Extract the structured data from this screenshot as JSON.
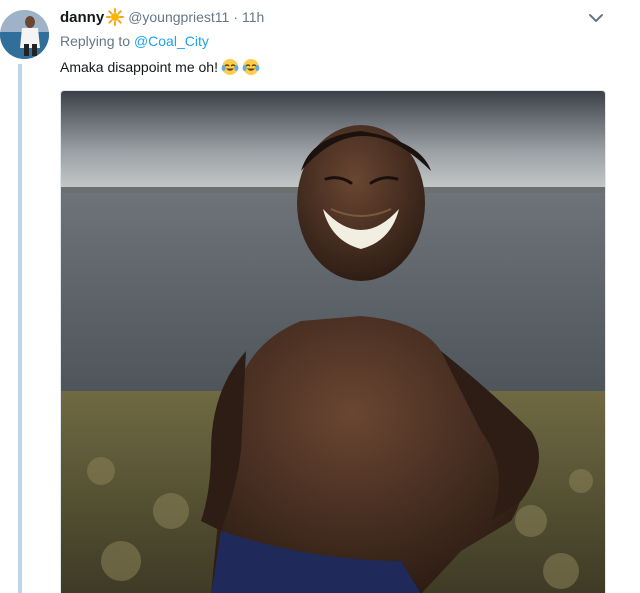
{
  "tweet": {
    "display_name": "danny",
    "handle": "@youngpriest11",
    "separator": "·",
    "time": "11h",
    "replying_prefix": "Replying to",
    "replying_to": "@Coal_City",
    "text": "Amaka disappoint me oh!",
    "emoji": [
      "face-with-tears-of-joy-icon",
      "face-with-tears-of-joy-icon"
    ],
    "badge_icon": "sun-icon",
    "menu_icon": "chevron-down-icon"
  },
  "colors": {
    "link": "#1da1f2",
    "secondary_text": "#657786",
    "primary_text": "#14171a",
    "thread_line": "#bdd7e8"
  }
}
